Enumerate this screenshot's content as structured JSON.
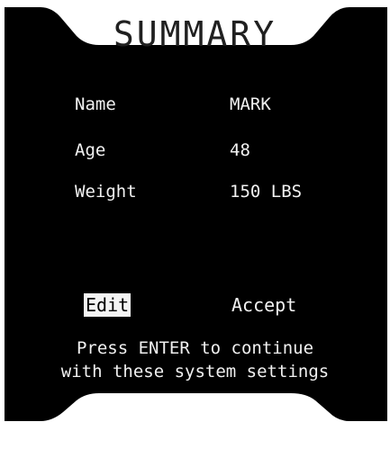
{
  "header": {
    "title": "SUMMARY"
  },
  "summary": {
    "fields": [
      {
        "label": "Name",
        "value": "MARK"
      },
      {
        "label": "Age",
        "value": "48"
      },
      {
        "label": "Weight",
        "value": "150 LBS"
      }
    ]
  },
  "actions": {
    "edit_label": "Edit",
    "accept_label": "Accept",
    "selected": "Edit"
  },
  "footer": {
    "line1": "Press ENTER to continue",
    "line2": "with these system settings"
  },
  "colors": {
    "background": "#000000",
    "frame": "#e8e8e8",
    "text": "#f2f2f2",
    "selected_bg": "#f5f5f5",
    "selected_text": "#000000"
  }
}
